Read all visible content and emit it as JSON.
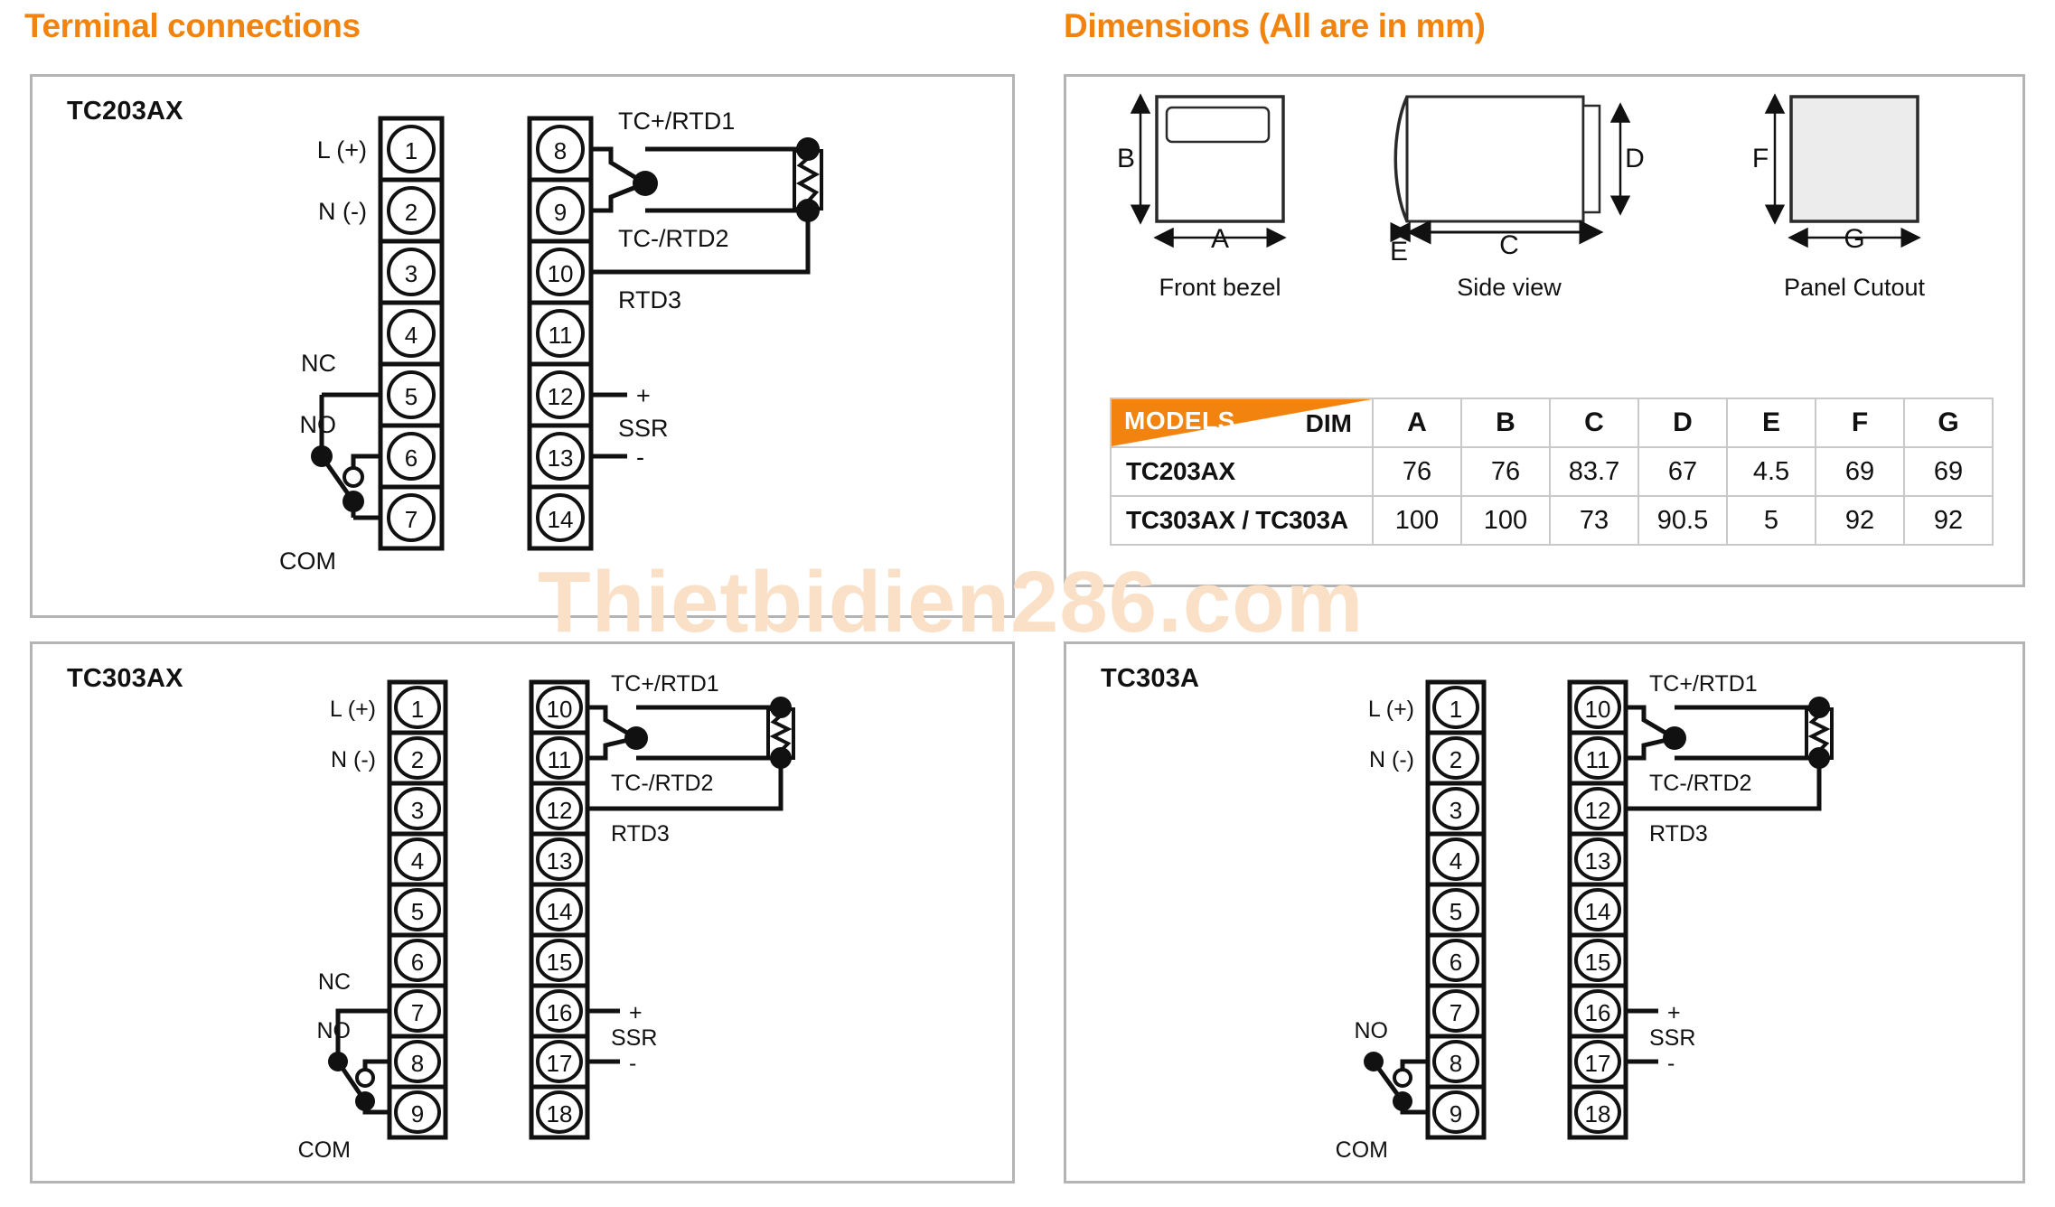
{
  "sections": {
    "terminal_title": "Terminal connections",
    "dimensions_title": "Dimensions (All are in mm)"
  },
  "watermark": "Thietbidien286.com",
  "colors": {
    "accent_orange": "#F2830E",
    "panel_border": "#b4b4b4",
    "line": "#111111",
    "cutout_fill": "#ececec"
  },
  "panels": {
    "tc203ax": {
      "label": "TC203AX",
      "left_strip": {
        "terminals": [
          "1",
          "2",
          "3",
          "4",
          "5",
          "6",
          "7"
        ],
        "labels": {
          "t1": "L (+)",
          "t2": "N (-)",
          "t5": "NC",
          "t6": "NO",
          "t7": "COM"
        }
      },
      "right_strip": {
        "terminals": [
          "8",
          "9",
          "10",
          "11",
          "12",
          "13",
          "14"
        ],
        "labels": {
          "t8": "TC+/RTD1",
          "t9": "TC-/RTD2",
          "t10": "RTD3",
          "t12": "+",
          "ssr": "SSR",
          "t13": "-"
        }
      }
    },
    "tc303ax": {
      "label": "TC303AX",
      "left_strip": {
        "terminals": [
          "1",
          "2",
          "3",
          "4",
          "5",
          "6",
          "7",
          "8",
          "9"
        ],
        "labels": {
          "t1": "L (+)",
          "t2": "N (-)",
          "t7": "NC",
          "t8": "NO",
          "t9": "COM"
        }
      },
      "right_strip": {
        "terminals": [
          "10",
          "11",
          "12",
          "13",
          "14",
          "15",
          "16",
          "17",
          "18"
        ],
        "labels": {
          "t10": "TC+/RTD1",
          "t11": "TC-/RTD2",
          "t12": "RTD3",
          "t16": "+",
          "ssr": "SSR",
          "t17": "-"
        }
      }
    },
    "tc303a": {
      "label": "TC303A",
      "left_strip": {
        "terminals": [
          "1",
          "2",
          "3",
          "4",
          "5",
          "6",
          "7",
          "8",
          "9"
        ],
        "labels": {
          "t1": "L (+)",
          "t2": "N (-)",
          "t8": "NO",
          "t9": "COM"
        }
      },
      "right_strip": {
        "terminals": [
          "10",
          "11",
          "12",
          "13",
          "14",
          "15",
          "16",
          "17",
          "18"
        ],
        "labels": {
          "t10": "TC+/RTD1",
          "t11": "TC-/RTD2",
          "t12": "RTD3",
          "t16": "+",
          "ssr": "SSR",
          "t17": "-"
        }
      }
    }
  },
  "dimension_views": [
    {
      "name": "Front bezel",
      "dims": [
        "A",
        "B"
      ],
      "height_label": "B",
      "width_label": "A"
    },
    {
      "name": "Side view",
      "dims": [
        "C",
        "D",
        "E"
      ],
      "width_label": "C",
      "height_label": "D",
      "bezel_label": "E"
    },
    {
      "name": "Panel Cutout",
      "dims": [
        "F",
        "G"
      ],
      "height_label": "F",
      "width_label": "G"
    }
  ],
  "dim_table": {
    "models_header": "MODELS",
    "dim_header": "DIM",
    "columns": [
      "A",
      "B",
      "C",
      "D",
      "E",
      "F",
      "G"
    ],
    "rows": [
      {
        "model": "TC203AX",
        "values": [
          "76",
          "76",
          "83.7",
          "67",
          "4.5",
          "69",
          "69"
        ]
      },
      {
        "model": "TC303AX / TC303A",
        "values": [
          "100",
          "100",
          "73",
          "90.5",
          "5",
          "92",
          "92"
        ]
      }
    ]
  }
}
